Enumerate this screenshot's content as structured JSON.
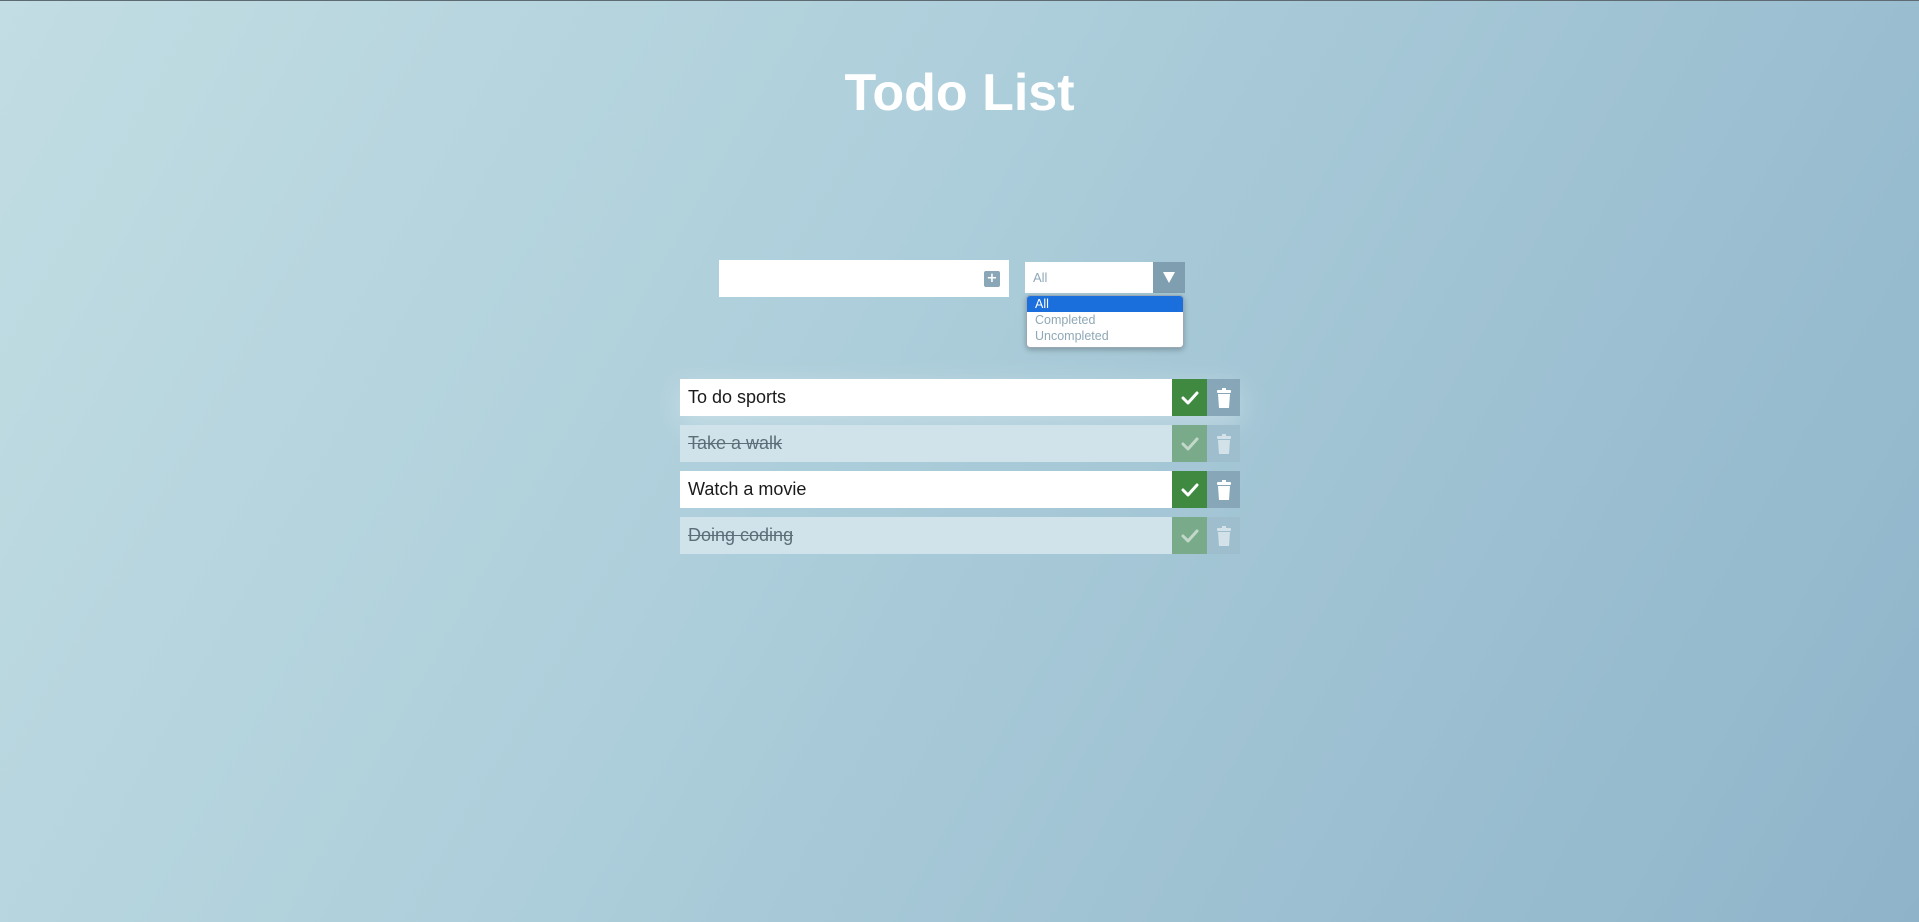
{
  "header": {
    "title": "Todo List"
  },
  "add_form": {
    "input_value": "",
    "add_icon": "plus-icon"
  },
  "filter": {
    "selected_value": "All",
    "arrow_icon": "triangle-down-icon",
    "options": [
      {
        "label": "All",
        "selected": true
      },
      {
        "label": "Completed",
        "selected": false
      },
      {
        "label": "Uncompleted",
        "selected": false
      }
    ]
  },
  "todos": [
    {
      "text": "To do sports",
      "completed": false
    },
    {
      "text": "Take a walk",
      "completed": true
    },
    {
      "text": "Watch a movie",
      "completed": false
    },
    {
      "text": "Doing coding",
      "completed": true
    }
  ],
  "icons": {
    "complete": "check-icon",
    "delete": "trash-icon"
  },
  "colors": {
    "check_active": "#3f8a40",
    "trash": "#87a7b8",
    "dropdown_selected": "#1a6fdc"
  }
}
